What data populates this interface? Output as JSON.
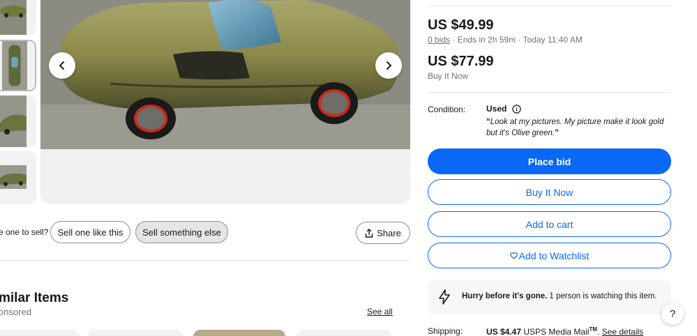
{
  "gallery": {
    "prev_icon": "chevron-left-icon",
    "next_icon": "chevron-right-icon"
  },
  "sell": {
    "prompt": "e one to sell?",
    "sell_like": "Sell one like this",
    "sell_else": "Sell something else"
  },
  "share": {
    "label": "Share",
    "icon": "share-icon"
  },
  "similar": {
    "title": "milar Items",
    "subtitle": "onsored",
    "see_all": "See all"
  },
  "pricing": {
    "bid_price": "US $49.99",
    "bids_link": "0 bids",
    "bid_meta": " · Ends in 2h 59m · Today 11:40 AM",
    "bin_price": "US $77.99",
    "bin_label": "Buy It Now"
  },
  "condition": {
    "label": "Condition:",
    "value": "Used",
    "info_icon": "info-icon",
    "quote": "Look at my pictures. My picture make it look gold but it's Olive green."
  },
  "actions": {
    "place_bid": "Place bid",
    "buy_now": "Buy It Now",
    "add_cart": "Add to cart",
    "watchlist": "Add to Watchlist",
    "watchlist_icon": "heart-icon"
  },
  "urgency": {
    "icon": "lightning-icon",
    "bold": "Hurry before it's gone.",
    "text": " 1 person is watching this item."
  },
  "shipping": {
    "label": "Shipping:",
    "price": "US $4.47",
    "service": " USPS Media Mail",
    "tm": "TM",
    "dot": ".",
    "details": "See details"
  },
  "help": {
    "label": "?"
  },
  "colors": {
    "accent": "#0968f6",
    "text": "#191919",
    "muted": "#707070"
  }
}
